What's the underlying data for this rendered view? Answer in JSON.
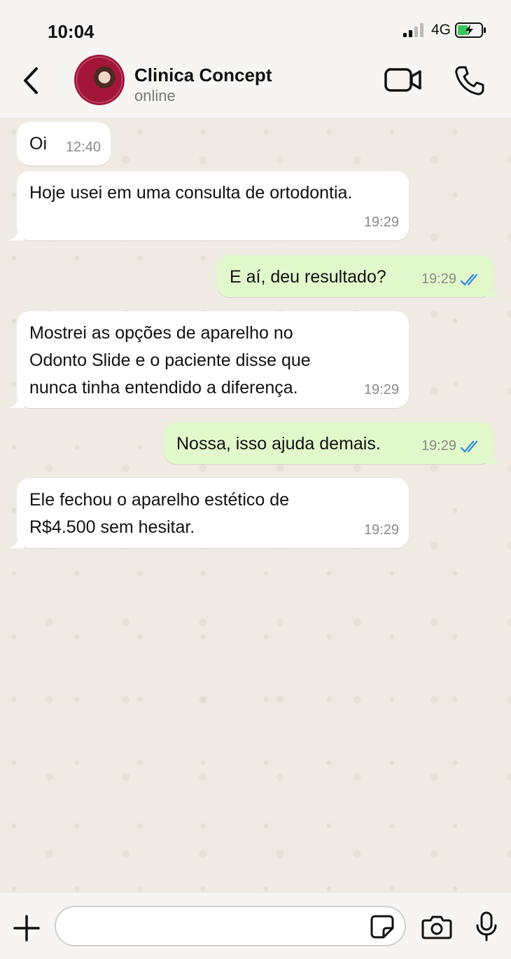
{
  "status_bar": {
    "time": "10:04",
    "network": "4G",
    "signal_icon": "signal-bars-icon",
    "battery_icon": "battery-charging-icon",
    "battery_color": "#34c759"
  },
  "header": {
    "contact_name": "Clinica Concept",
    "contact_status": "online",
    "avatar_icon": "contact-avatar"
  },
  "messages": [
    {
      "direction": "in",
      "text": "Oi",
      "time": "12:40"
    },
    {
      "direction": "in",
      "text": "Hoje usei em uma consulta de ortodontia.",
      "time": "19:29"
    },
    {
      "direction": "out",
      "text": "E aí, deu resultado?",
      "time": "19:29",
      "status": "read"
    },
    {
      "direction": "in",
      "text_lines": [
        "Mostrei as opções de aparelho no",
        "Odonto Slide e o paciente disse que",
        "nunca tinha entendido a diferença."
      ],
      "time": "19:29"
    },
    {
      "direction": "out",
      "text": "Nossa, isso ajuda demais.",
      "time": "19:29",
      "status": "read"
    },
    {
      "direction": "in",
      "text_lines": [
        "Ele fechou o aparelho estético de",
        "R$4.500 sem hesitar."
      ],
      "time": "19:29"
    }
  ],
  "input_bar": {
    "message_value": "",
    "message_placeholder": ""
  },
  "colors": {
    "incoming_bubble": "#ffffff",
    "outgoing_bubble": "#e1f8cb",
    "read_ticks": "#3a8ee6",
    "chat_background": "#efeae2"
  }
}
